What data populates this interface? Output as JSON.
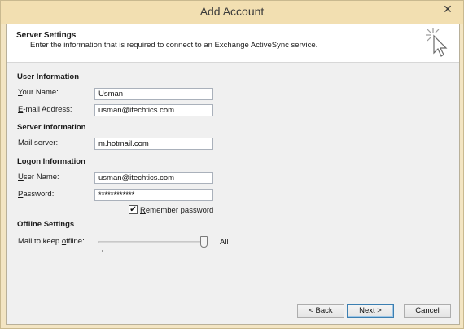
{
  "window": {
    "title": "Add Account",
    "close_glyph": "✕"
  },
  "header": {
    "title": "Server Settings",
    "subtitle": "Enter the information that is required to connect to an Exchange ActiveSync service.",
    "icon": "cursor-sparkle-icon"
  },
  "sections": {
    "user_info": "User Information",
    "server_info": "Server Information",
    "logon_info": "Logon Information",
    "offline": "Offline Settings"
  },
  "fields": {
    "your_name": {
      "label_pre": "",
      "label_key": "Y",
      "label_post": "our Name:",
      "value": "Usman"
    },
    "email": {
      "label_pre": "",
      "label_key": "E",
      "label_post": "-mail Address:",
      "value": "usman@itechtics.com"
    },
    "mail_server": {
      "label_pre": "Mail server:",
      "label_key": "",
      "label_post": "",
      "value": "m.hotmail.com"
    },
    "user_name": {
      "label_pre": "",
      "label_key": "U",
      "label_post": "ser Name:",
      "value": "usman@itechtics.com"
    },
    "password": {
      "label_pre": "",
      "label_key": "P",
      "label_post": "assword:",
      "value": "************"
    }
  },
  "remember": {
    "checked": true,
    "check_glyph": "✔",
    "label_key": "R",
    "label_post": "emember password"
  },
  "offline": {
    "label_pre": "Mail to keep ",
    "label_key": "o",
    "label_post": "ffline:",
    "value_label": "All",
    "level": 1.0
  },
  "buttons": {
    "back": {
      "pre": "< ",
      "key": "B",
      "post": "ack"
    },
    "next": {
      "pre": "",
      "key": "N",
      "post": "ext >"
    },
    "cancel": {
      "label": "Cancel"
    }
  }
}
